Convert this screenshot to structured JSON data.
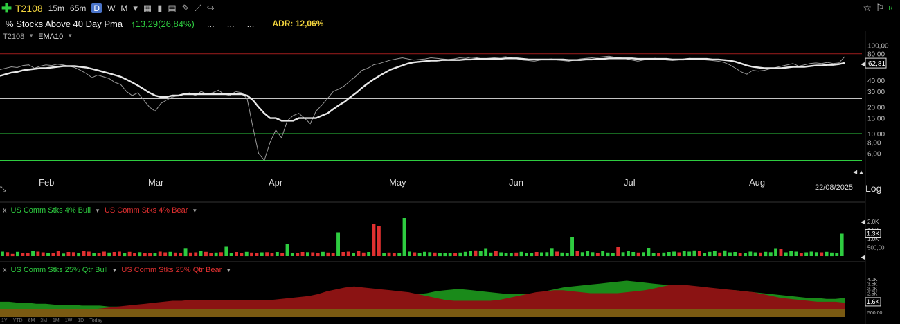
{
  "toolbar": {
    "symbol": "T2108",
    "timeframes": [
      "15m",
      "65m",
      "D",
      "W",
      "M"
    ],
    "active_timeframe": "D"
  },
  "info": {
    "name": "% Stocks Above 40 Day Pma",
    "change": "13,29(26,84%)",
    "dots": [
      "...",
      "...",
      "..."
    ],
    "adr": "ADR: 12,06%"
  },
  "legend": {
    "symbol": "T2108",
    "indicator": "EMA10"
  },
  "main_axis": {
    "last_value_label": "62,81",
    "date_label": "22/08/2025",
    "log_label": "Log",
    "months": [
      "Feb",
      "Mar",
      "Apr",
      "May",
      "Jun",
      "Jul",
      "Aug"
    ],
    "y_ticks": [
      "100,00",
      "80,00",
      "60,00",
      "40,00",
      "30,00",
      "20,00",
      "15,00",
      "10,00",
      "8,00",
      "6,00"
    ]
  },
  "pane2": {
    "x_label": "x",
    "bull_label": "US Comm Stks 4% Bull",
    "bear_label": "US Comm Stks 4% Bear",
    "ticks": [
      "2.0K",
      "1.5K",
      "1.0K",
      "500,00"
    ],
    "last_label": "1.3K"
  },
  "pane3": {
    "x_label": "x",
    "bull_label": "US Comm Stks 25% Qtr Bull",
    "bear_label": "US Comm Stks 25% Qtr Bear",
    "ticks": [
      "4.0K",
      "3.5K",
      "3.0K",
      "2.5K",
      "500,00"
    ],
    "last_label": "1.6K"
  },
  "bottom_tf": [
    "1Y",
    "YTD",
    "6M",
    "3M",
    "1M",
    "1W",
    "1D",
    "Today"
  ],
  "colors": {
    "bull": "#2ecc40",
    "bear": "#e03030",
    "ema": "#e8e8e8",
    "price": "#9a9a9a"
  },
  "chart_data": [
    {
      "type": "line",
      "scale": "log",
      "ylim": [
        4,
        110
      ],
      "horizontal_lines": [
        {
          "value": 80,
          "color": "#8b1a1a"
        },
        {
          "value": 25,
          "color": "#e0e0e0"
        },
        {
          "value": 10,
          "color": "#2ecc40"
        },
        {
          "value": 5,
          "color": "#2ecc40"
        }
      ],
      "x_month_labels": [
        "Feb",
        "Mar",
        "Apr",
        "May",
        "Jun",
        "Jul",
        "Aug"
      ],
      "series": [
        {
          "values": [
            53,
            55,
            57,
            56,
            59,
            60,
            55,
            58,
            60,
            59,
            61,
            60,
            58,
            56,
            52,
            48,
            43,
            46,
            44,
            42,
            38,
            36,
            30,
            27,
            29,
            24,
            20,
            18,
            22,
            24,
            26,
            27,
            28,
            29,
            27,
            30,
            28,
            29,
            31,
            28,
            27,
            30,
            29,
            25,
            12,
            6,
            5,
            8,
            11,
            9,
            14,
            16,
            17,
            15,
            13,
            18,
            21,
            25,
            30,
            32,
            35,
            40,
            45,
            52,
            55,
            60,
            62,
            65,
            68,
            70,
            72,
            70,
            68,
            69,
            70,
            72,
            71,
            70,
            69,
            70,
            72,
            71,
            73,
            72,
            70,
            71,
            72,
            73,
            74,
            72,
            70,
            68,
            67,
            66,
            68,
            69,
            70,
            68,
            67,
            66,
            68,
            70,
            71,
            72,
            73,
            74,
            75,
            73,
            72,
            70,
            68,
            66,
            68,
            70,
            71,
            70,
            68,
            67,
            68,
            70,
            71,
            70,
            69,
            68,
            67,
            66,
            64,
            60,
            55,
            50,
            47,
            52,
            51,
            52,
            54,
            56,
            58,
            60,
            62,
            58,
            60,
            62,
            63,
            62,
            64,
            62,
            63,
            74
          ]
        },
        {
          "values": [
            45,
            47,
            49,
            50,
            52,
            53,
            54,
            55,
            55,
            56,
            57,
            58,
            58,
            58,
            57,
            56,
            54,
            52,
            50,
            48,
            46,
            44,
            41,
            38,
            35,
            32,
            29,
            27,
            26,
            26,
            27,
            27,
            28,
            28,
            28,
            28,
            28,
            28,
            28,
            28,
            28,
            28,
            28,
            27,
            24,
            20,
            17,
            15,
            15,
            14,
            14,
            14,
            15,
            15,
            15,
            15,
            16,
            17,
            19,
            21,
            23,
            26,
            29,
            33,
            37,
            41,
            45,
            49,
            53,
            56,
            59,
            62,
            64,
            65,
            66,
            67,
            67,
            68,
            68,
            68,
            68,
            69,
            69,
            70,
            70,
            70,
            70,
            70,
            71,
            71,
            71,
            70,
            69,
            69,
            69,
            69,
            69,
            69,
            69,
            68,
            68,
            68,
            69,
            69,
            70,
            70,
            71,
            71,
            71,
            71,
            71,
            70,
            70,
            70,
            70,
            70,
            70,
            69,
            69,
            69,
            70,
            70,
            70,
            70,
            69,
            69,
            68,
            67,
            65,
            62,
            59,
            57,
            56,
            55,
            55,
            55,
            55,
            56,
            57,
            57,
            57,
            58,
            59,
            59,
            60,
            60,
            61,
            63
          ]
        }
      ]
    },
    {
      "type": "bar",
      "series": [
        {
          "values": [
            260,
            230,
            130,
            250,
            200,
            180,
            300,
            260,
            220,
            200,
            180,
            280,
            150,
            240,
            230,
            190,
            300,
            260,
            160,
            180,
            260,
            210,
            240,
            260,
            190,
            250,
            200,
            230,
            190,
            170,
            180,
            260,
            220,
            250,
            210,
            160,
            470,
            210,
            220,
            320,
            250,
            180,
            210,
            230,
            540,
            180,
            240,
            200,
            250,
            210,
            180,
            220,
            230,
            190,
            240,
            200,
            720,
            180,
            200,
            240,
            230,
            220,
            190,
            250,
            210,
            200,
            1380,
            240,
            260,
            200,
            320,
            210,
            240,
            1860,
            1760,
            200,
            210,
            170,
            160,
            2200,
            260,
            220,
            180,
            250,
            230,
            210,
            190,
            190,
            190,
            180,
            210,
            250,
            300,
            330,
            280,
            460,
            210,
            300,
            220,
            180,
            190,
            210,
            250,
            200,
            190,
            240,
            220,
            230,
            470,
            260,
            210,
            200,
            1100,
            280,
            230,
            300,
            230,
            180,
            300,
            210,
            200,
            520,
            230,
            280,
            240,
            210,
            230,
            480,
            200,
            190,
            210,
            240,
            260,
            220,
            310,
            260,
            330,
            280,
            180,
            250,
            280,
            210,
            330,
            220,
            240,
            200,
            190,
            260,
            220,
            210,
            250,
            230,
            460,
            420,
            220,
            290,
            260,
            190,
            220,
            260,
            230,
            220,
            250,
            210,
            160,
            1300
          ]
        },
        {
          "values": [
            0,
            0,
            1,
            0,
            0,
            0,
            0,
            0,
            0,
            0,
            0,
            0,
            0,
            0,
            0,
            0,
            0,
            0,
            0,
            0,
            0,
            0,
            0,
            0,
            0,
            0,
            0,
            0,
            0,
            0,
            0,
            0,
            0,
            0,
            0,
            0,
            0,
            0,
            0,
            0,
            0,
            0,
            0,
            0,
            0,
            0,
            0,
            0,
            0,
            0,
            0,
            0,
            0,
            0,
            0,
            0,
            0,
            0,
            0,
            0,
            0,
            0,
            0,
            0,
            0,
            0,
            0,
            0,
            0,
            0,
            0,
            0,
            0,
            0,
            0,
            0,
            0,
            0,
            0,
            1,
            0,
            0,
            0,
            0,
            0,
            0,
            0,
            0,
            0,
            0,
            0,
            0,
            0,
            0,
            0,
            0,
            0,
            0,
            0,
            0,
            0,
            0,
            0,
            0,
            0,
            0,
            0,
            0,
            0,
            0,
            0,
            0,
            0,
            0,
            0,
            0,
            0,
            0,
            0,
            0,
            0,
            0,
            0,
            0,
            0,
            0,
            0,
            0,
            0,
            0,
            0,
            0,
            0,
            0,
            0,
            0,
            0,
            0,
            0,
            0,
            0,
            0,
            0,
            0,
            0,
            0,
            0,
            0,
            0,
            0,
            0,
            0,
            0,
            0,
            0,
            0,
            0,
            0,
            0,
            0,
            0,
            0,
            0,
            0,
            0,
            0,
            0,
            1
          ]
        }
      ]
    },
    {
      "type": "area",
      "series": [
        {
          "values": [
            700,
            700,
            700,
            700,
            700,
            700,
            700,
            700,
            700,
            700,
            800,
            900,
            1000,
            1100,
            1200,
            1300,
            1400,
            1500,
            1600,
            1700,
            1700,
            1800,
            1800,
            1800,
            1800,
            1800,
            1800,
            1800,
            1800,
            1800,
            1800,
            1900,
            2000,
            2100,
            2200,
            2400,
            2700,
            2900,
            3100,
            3200,
            3100,
            3000,
            2900,
            2800,
            2700,
            2600,
            2400,
            2200,
            2000,
            1800,
            1700,
            1700,
            1700,
            1700,
            1700,
            1800,
            2000,
            2200,
            2400,
            2600,
            2700,
            2800,
            2800,
            2700,
            2600,
            2500,
            2500,
            2500,
            2500,
            2600,
            2700,
            2800,
            3000,
            3200,
            3400,
            3400,
            3300,
            3200,
            3100,
            3000,
            2900,
            2800,
            2700,
            2600,
            2400,
            2200,
            2000,
            1900,
            1800,
            1700,
            1600,
            1600,
            1600,
            1500
          ]
        },
        {
          "values": [
            1600,
            1600,
            1500,
            1500,
            1400,
            1400,
            1300,
            1300,
            1300,
            1200,
            1200,
            1200,
            1100,
            1100,
            1100,
            1000,
            1000,
            1000,
            1000,
            1000,
            1000,
            1100,
            1100,
            1100,
            1100,
            1200,
            1200,
            1200,
            1200,
            1300,
            1400,
            1500,
            1600,
            1700,
            1800,
            1800,
            1900,
            1900,
            2000,
            2100,
            2100,
            2200,
            2200,
            2300,
            2300,
            2400,
            2400,
            2500,
            2700,
            2800,
            2900,
            2900,
            2800,
            2700,
            2600,
            2500,
            2400,
            2400,
            2400,
            2500,
            2700,
            2900,
            3100,
            3200,
            3300,
            3400,
            3500,
            3600,
            3700,
            3800,
            3700,
            3600,
            3500,
            3400,
            3300,
            3200,
            3100,
            3000,
            3000,
            2900,
            2800,
            2800,
            2700,
            2600,
            2500,
            2400,
            2300,
            2200,
            2100,
            2000,
            2000,
            1900,
            1900,
            2000
          ]
        }
      ]
    }
  ]
}
